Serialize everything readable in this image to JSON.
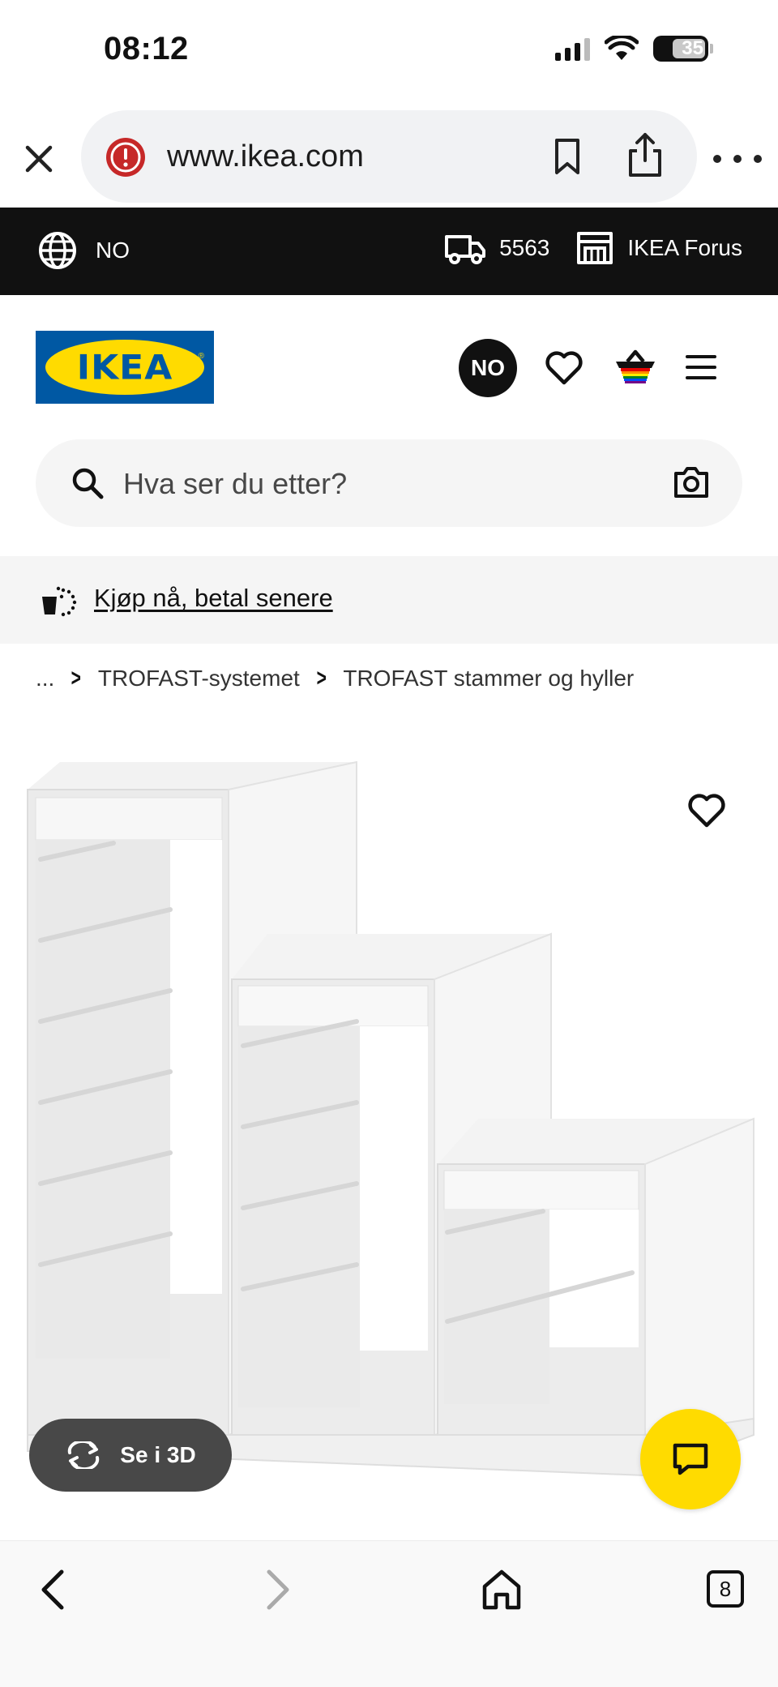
{
  "status_bar": {
    "time": "08:12",
    "battery": "35"
  },
  "browser": {
    "url": "www.ikea.com",
    "icons": [
      "close-icon",
      "warning-icon",
      "bookmark-icon",
      "share-icon",
      "more-icon"
    ]
  },
  "top_strip": {
    "language": "NO",
    "postcode": "5563",
    "store": "IKEA Forus",
    "icons": [
      "globe-icon",
      "delivery-truck-icon",
      "store-icon"
    ]
  },
  "header": {
    "logo": "IKEA",
    "avatar_initials": "NO",
    "icons": [
      "heart-icon",
      "shopping-basket-icon",
      "hamburger-menu-icon"
    ]
  },
  "search": {
    "placeholder": "Hva ser du etter?",
    "icons": [
      "search-icon",
      "camera-icon"
    ]
  },
  "promo": {
    "link_text": "Kjøp nå, betal senere"
  },
  "breadcrumb": {
    "items": [
      "...",
      "TROFAST-systemet",
      "TROFAST stammer og hyller"
    ]
  },
  "product": {
    "view_3d_label": "Se i 3D",
    "icons": [
      "favourite-heart-icon",
      "rotate-3d-icon",
      "chat-icon"
    ]
  },
  "bottom_nav": {
    "tab_count": "8",
    "icons": [
      "back-icon",
      "forward-icon",
      "home-icon",
      "tabs-icon"
    ]
  },
  "colors": {
    "ikea_blue": "#0058a3",
    "ikea_yellow": "#ffdb00",
    "strip_black": "#111111",
    "warning_red": "#d32f2f"
  }
}
